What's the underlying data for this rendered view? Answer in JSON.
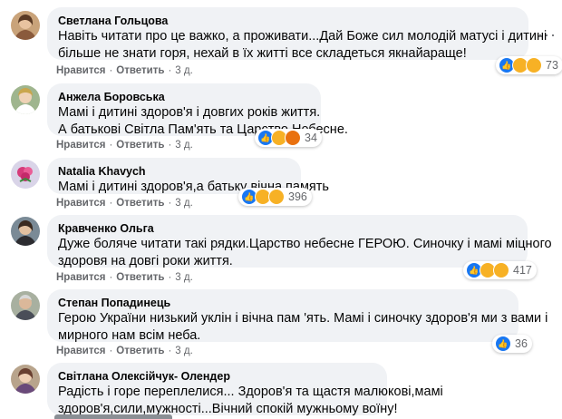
{
  "comments": [
    {
      "author": "Светлана Гольцова",
      "lines": [
        "Навіть читати про це важко, а проживати...Дай Боже сил молодій матусі і дитині",
        "більше не знати горя, нехай в їх житті все складеться якнайараще!"
      ],
      "actions": {
        "like": "Нравится",
        "reply": "Ответить",
        "time": "3 д."
      },
      "reactions": [
        "like",
        "sad",
        "sad"
      ],
      "reaction_count": "73"
    },
    {
      "author": "Анжела Боровська",
      "lines": [
        "Мамі і дитині здоров'я і довгих років життя.",
        "А батькові Світла Пам'ять та Царство Небесне."
      ],
      "actions": {
        "like": "Нравится",
        "reply": "Ответить",
        "time": "3 д."
      },
      "reactions": [
        "like",
        "sad",
        "angry"
      ],
      "reaction_count": "34"
    },
    {
      "author": "Natalia Khavych",
      "lines": [
        "Мамі і дитині здоров'я,а батьку вічна память"
      ],
      "actions": {
        "like": "Нравится",
        "reply": "Ответить",
        "time": "3 д."
      },
      "reactions": [
        "like",
        "sad",
        "sad"
      ],
      "reaction_count": "396"
    },
    {
      "author": "Кравченко Ольга",
      "lines": [
        "Дуже боляче читати такі рядки.Царство небесне ГЕРОЮ. Синочку і мамі міцного",
        "здоровя на довгі роки життя."
      ],
      "actions": {
        "like": "Нравится",
        "reply": "Ответить",
        "time": "3 д."
      },
      "reactions": [
        "like",
        "sad",
        "sad"
      ],
      "reaction_count": "417"
    },
    {
      "author": "Степан Попадинець",
      "lines": [
        "Герою України низький уклін і вічна пам 'ять. Мамі і синочку здоров'я ми з вами і",
        "мирного нам всім неба."
      ],
      "actions": {
        "like": "Нравится",
        "reply": "Ответить",
        "time": "3 д."
      },
      "reactions": [
        "like"
      ],
      "reaction_count": "36"
    },
    {
      "author": "Світлана Олексійчук- Олендер",
      "lines": [
        "Радість і горе переплелися... Здоров'я та щастя малюкові,мамі",
        "здоров'я,сили,мужності...Вічний спокій мужньому воїну!"
      ],
      "actions": {
        "like": "",
        "reply": "",
        "time": ""
      },
      "reactions": [],
      "reaction_count": ""
    }
  ],
  "more_icon": "more-horizontal-icon",
  "more_glyph": "···",
  "colors": {
    "bubble": "#f0f2f5",
    "like": "#1877f2",
    "sad": "#f7b125",
    "angry": "#e9710f",
    "meta": "#65676b"
  }
}
